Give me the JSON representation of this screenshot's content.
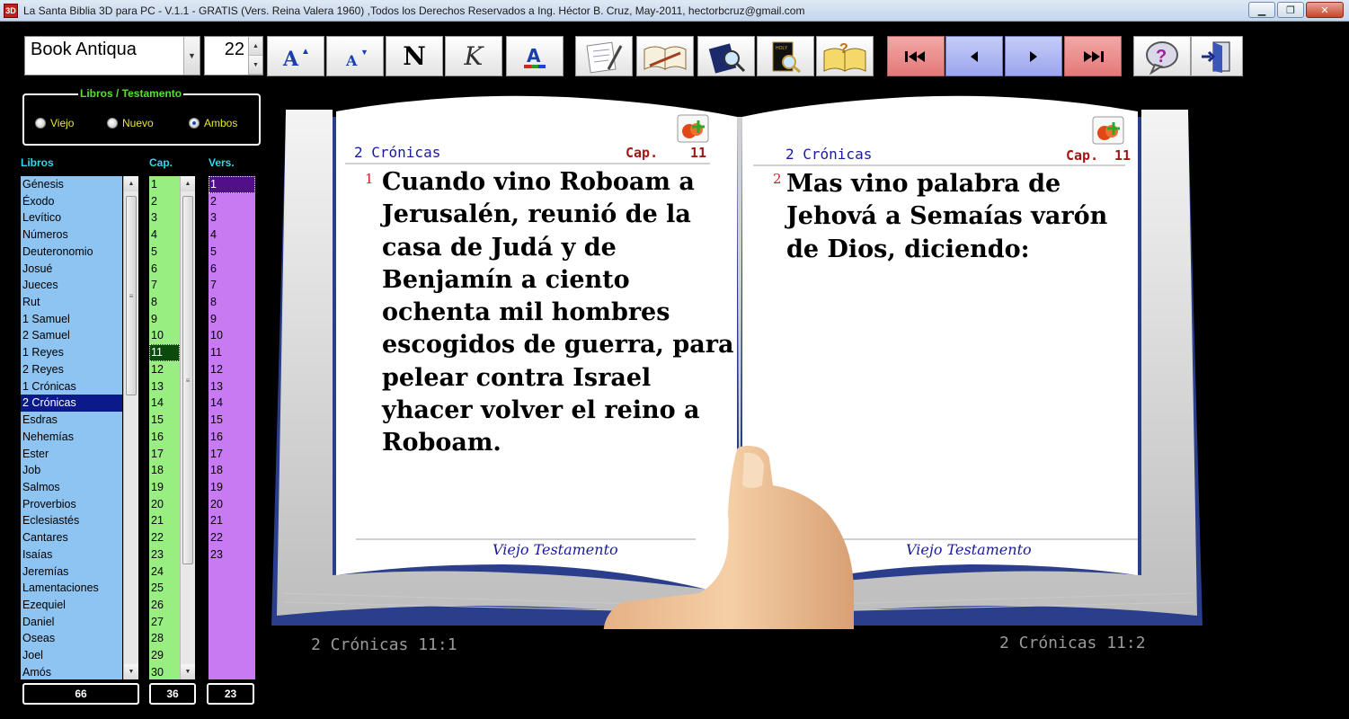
{
  "window": {
    "title": "La Santa Biblia 3D para PC - V.1.1 - GRATIS (Vers. Reina Valera 1960) ,Todos los Derechos Reservados  a Ing. Héctor B. Cruz, May-2011, hectorbcruz@gmail.com",
    "icon_text": "3D"
  },
  "toolbar": {
    "font_value": "Book Antiqua",
    "size_value": "22",
    "bold_label": "N",
    "italic_label": "K"
  },
  "group": {
    "title": "Libros / Testamento",
    "options": [
      "Viejo",
      "Nuevo",
      "Ambos"
    ],
    "selected": "Ambos"
  },
  "columns": {
    "books": "Libros",
    "chapters": "Cap.",
    "verses": "Vers."
  },
  "books": [
    "Génesis",
    "Éxodo",
    "Levítico",
    "Números",
    "Deuteronomio",
    "Josué",
    "Jueces",
    "Rut",
    "1 Samuel",
    "2 Samuel",
    "1 Reyes",
    "2 Reyes",
    "1 Crónicas",
    "2 Crónicas",
    "Esdras",
    "Nehemías",
    "Ester",
    "Job",
    "Salmos",
    "Proverbios",
    "Eclesiastés",
    "Cantares",
    "Isaías",
    "Jeremías",
    "Lamentaciones",
    "Ezequiel",
    "Daniel",
    "Oseas",
    "Joel",
    "Amós"
  ],
  "selected_book": "2 Crónicas",
  "chapters": [
    "1",
    "2",
    "3",
    "4",
    "5",
    "6",
    "7",
    "8",
    "9",
    "10",
    "11",
    "12",
    "13",
    "14",
    "15",
    "16",
    "17",
    "18",
    "19",
    "20",
    "21",
    "22",
    "23",
    "24",
    "25",
    "26",
    "27",
    "28",
    "29",
    "30"
  ],
  "selected_chapter": "11",
  "verses": [
    "1",
    "2",
    "3",
    "4",
    "5",
    "6",
    "7",
    "8",
    "9",
    "10",
    "11",
    "12",
    "13",
    "14",
    "15",
    "16",
    "17",
    "18",
    "19",
    "20",
    "21",
    "22",
    "23"
  ],
  "selected_verse": "1",
  "counts": {
    "books": "66",
    "chapters": "36",
    "verses": "23"
  },
  "left_page": {
    "book": "2 Crónicas",
    "cap_label": "Cap.",
    "cap_value": "11",
    "verse_number": "1",
    "lines": [
      "Cuando vino Roboam a",
      "Jerusalén, reunió de la",
      "casa de Judá y de",
      "Benjamín a ciento",
      "ochenta mil hombres",
      "escogidos de guerra, para",
      "pelear contra Israel",
      "yhacer volver el reino a",
      "Roboam."
    ],
    "footer": "Viejo Testamento"
  },
  "right_page": {
    "book": "2 Crónicas",
    "cap_label": "Cap.",
    "cap_value": "11",
    "verse_number": "2",
    "lines": [
      "Mas vino palabra de",
      "Jehová a Semaías varón",
      "de Dios, diciendo:"
    ],
    "footer": "Viejo Testamento"
  },
  "references": {
    "left": "2 Crónicas 11:1",
    "right": "2 Crónicas 11:2"
  },
  "colors": {
    "books_bg": "#8ec4f2",
    "chapters_bg": "#98ee80",
    "verses_bg": "#c87af2",
    "nav_red": "#e57878",
    "nav_blue": "#9aa6ee"
  }
}
